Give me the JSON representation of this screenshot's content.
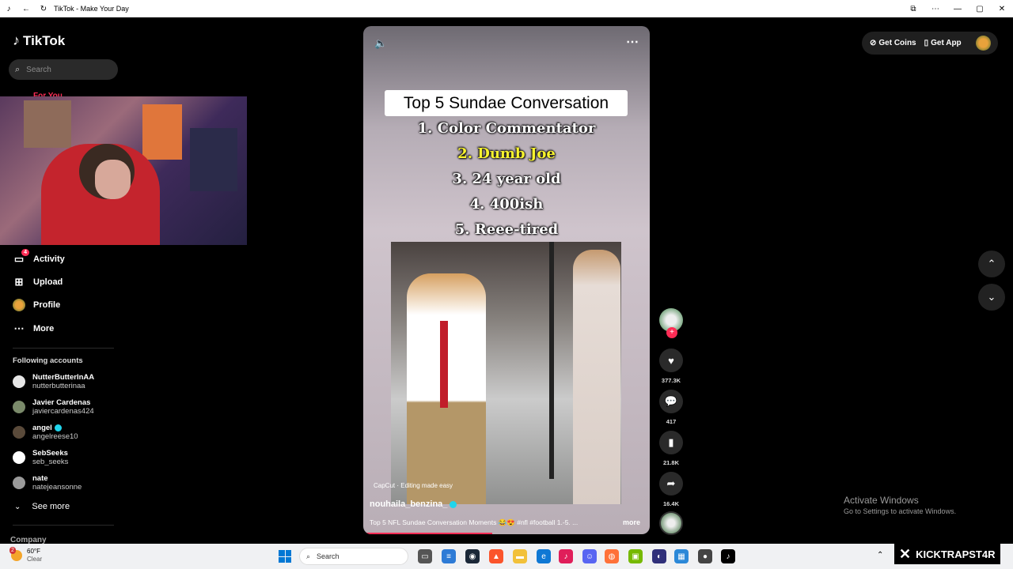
{
  "window": {
    "title": "TikTok - Make Your Day"
  },
  "sidebar": {
    "logo_text": "TikTok",
    "search_placeholder": "Search",
    "partial_item": "For You",
    "nav": [
      {
        "label": "Activity",
        "icon": "activity-icon",
        "badge": "4"
      },
      {
        "label": "Upload",
        "icon": "upload-icon"
      },
      {
        "label": "Profile",
        "icon": "profile-avatar"
      },
      {
        "label": "More",
        "icon": "more-icon"
      }
    ],
    "following_title": "Following accounts",
    "accounts": [
      {
        "name": "NutterButterInAA",
        "handle": "nutterbutterinaa",
        "verified": false
      },
      {
        "name": "Javier Cardenas",
        "handle": "javiercardenas424",
        "verified": false
      },
      {
        "name": "angel",
        "handle": "angelreese10",
        "verified": true
      },
      {
        "name": "SebSeeks",
        "handle": "seb_seeks",
        "verified": false
      },
      {
        "name": "nate",
        "handle": "natejeansonne",
        "verified": false
      }
    ],
    "see_more": "See more",
    "company": "Company"
  },
  "video": {
    "title": "Top 5 Sundae Conversation",
    "ranks": [
      "1. Color Commentator",
      "2. Dumb Joe",
      "3. 24 year old",
      "4. 400ish",
      "5. Reee-tired"
    ],
    "highlighted_rank": 1,
    "capcut": "CapCut · Editing made easy",
    "author": "nouhaila_benzina_",
    "caption": "Top 5 NFL Sundae Conversation Moments 😂😍 #nfl #football 1.-5. ...",
    "more": "more",
    "progress": 0.45
  },
  "actions": {
    "likes": "377.3K",
    "comments": "417",
    "saves": "21.8K",
    "shares": "16.4K"
  },
  "topbar": {
    "get_coins": "Get Coins",
    "get_app": "Get App"
  },
  "watermark": {
    "line1": "Activate Windows",
    "line2": "Go to Settings to activate Windows."
  },
  "taskbar": {
    "temp": "60°F",
    "condition": "Clear",
    "weather_badge": "2",
    "search_placeholder": "Search"
  },
  "overlay": {
    "kick_text": "KICKTRAPST4R"
  },
  "colors": {
    "accent": "#fe2c55",
    "highlight": "#f7f32e",
    "verified": "#20d5ec"
  }
}
